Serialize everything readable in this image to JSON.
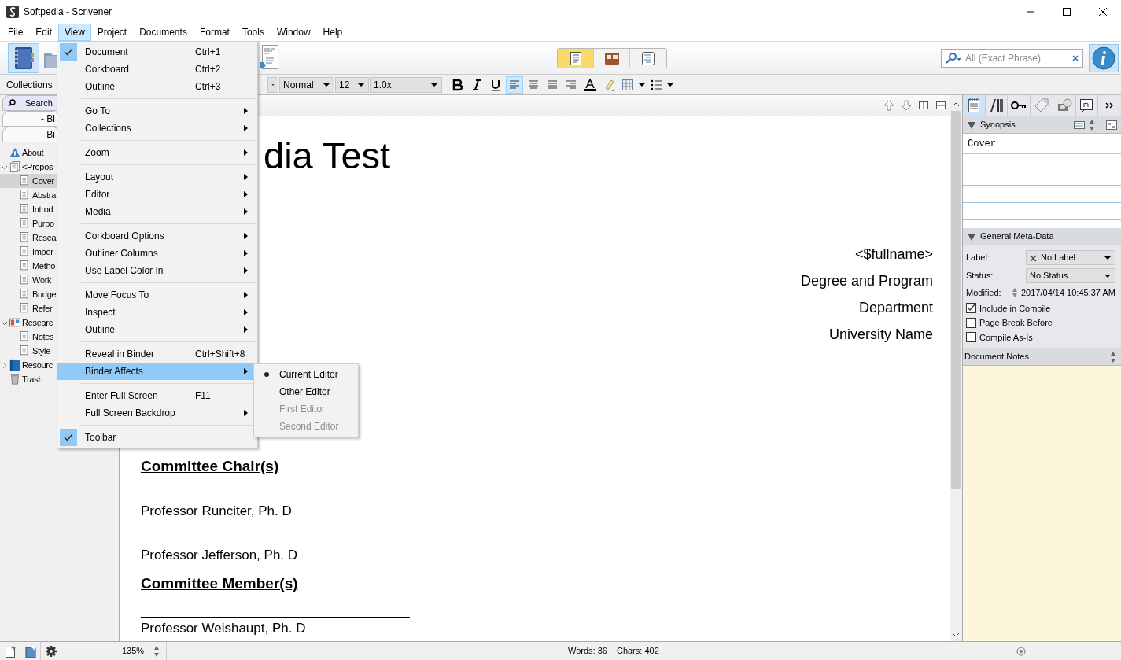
{
  "window": {
    "title": "Softpedia - Scrivener"
  },
  "menubar": [
    {
      "label": "File",
      "selected": false
    },
    {
      "label": "Edit",
      "selected": false
    },
    {
      "label": "View",
      "selected": true
    },
    {
      "label": "Project",
      "selected": false
    },
    {
      "label": "Documents",
      "selected": false
    },
    {
      "label": "Format",
      "selected": false
    },
    {
      "label": "Tools",
      "selected": false
    },
    {
      "label": "Window",
      "selected": false
    },
    {
      "label": "Help",
      "selected": false
    }
  ],
  "view_menu": [
    {
      "kind": "item",
      "label": "Document",
      "shortcut": "Ctrl+1",
      "checked": true,
      "submenu": false,
      "selected": false
    },
    {
      "kind": "item",
      "label": "Corkboard",
      "shortcut": "Ctrl+2",
      "checked": false,
      "submenu": false,
      "selected": false
    },
    {
      "kind": "item",
      "label": "Outline",
      "shortcut": "Ctrl+3",
      "checked": false,
      "submenu": false,
      "selected": false
    },
    {
      "kind": "separator"
    },
    {
      "kind": "item",
      "label": "Go To",
      "checked": false,
      "submenu": true,
      "selected": false
    },
    {
      "kind": "item",
      "label": "Collections",
      "checked": false,
      "submenu": true,
      "selected": false
    },
    {
      "kind": "separator"
    },
    {
      "kind": "item",
      "label": "Zoom",
      "checked": false,
      "submenu": true,
      "selected": false
    },
    {
      "kind": "separator"
    },
    {
      "kind": "item",
      "label": "Layout",
      "checked": false,
      "submenu": true,
      "selected": false
    },
    {
      "kind": "item",
      "label": "Editor",
      "checked": false,
      "submenu": true,
      "selected": false
    },
    {
      "kind": "item",
      "label": "Media",
      "checked": false,
      "submenu": true,
      "selected": false
    },
    {
      "kind": "separator"
    },
    {
      "kind": "item",
      "label": "Corkboard Options",
      "checked": false,
      "submenu": true,
      "selected": false
    },
    {
      "kind": "item",
      "label": "Outliner Columns",
      "checked": false,
      "submenu": true,
      "selected": false
    },
    {
      "kind": "item",
      "label": "Use Label Color In",
      "checked": false,
      "submenu": true,
      "selected": false
    },
    {
      "kind": "separator"
    },
    {
      "kind": "item",
      "label": "Move Focus To",
      "checked": false,
      "submenu": true,
      "selected": false
    },
    {
      "kind": "item",
      "label": "Inspect",
      "checked": false,
      "submenu": true,
      "selected": false
    },
    {
      "kind": "item",
      "label": "Outline",
      "checked": false,
      "submenu": true,
      "selected": false
    },
    {
      "kind": "separator"
    },
    {
      "kind": "item",
      "label": "Reveal in Binder",
      "shortcut": "Ctrl+Shift+8",
      "checked": false,
      "submenu": false,
      "selected": false
    },
    {
      "kind": "item",
      "label": "Binder Affects",
      "checked": false,
      "submenu": true,
      "selected": true
    },
    {
      "kind": "separator"
    },
    {
      "kind": "item",
      "label": "Enter Full Screen",
      "shortcut": "F11",
      "checked": false,
      "submenu": false,
      "selected": false
    },
    {
      "kind": "item",
      "label": "Full Screen Backdrop",
      "checked": false,
      "submenu": true,
      "selected": false
    },
    {
      "kind": "separator"
    },
    {
      "kind": "item",
      "label": "Toolbar",
      "checked": true,
      "submenu": false,
      "selected": false
    }
  ],
  "binder_affects_menu": [
    {
      "label": "Current Editor",
      "selected": true,
      "disabled": false
    },
    {
      "label": "Other Editor",
      "selected": false,
      "disabled": false
    },
    {
      "label": "First Editor",
      "selected": false,
      "disabled": true
    },
    {
      "label": "Second Editor",
      "selected": false,
      "disabled": true
    }
  ],
  "toolbar": {
    "view_modes": [
      {
        "selected": true
      },
      {
        "selected": false
      },
      {
        "selected": false
      }
    ],
    "search": {
      "placeholder": "All (Exact Phrase)"
    }
  },
  "format_bar": {
    "collections_label": "Collections",
    "style": "Normal",
    "size": "12",
    "spacing": "1.0x"
  },
  "binder": {
    "tabs": [
      {
        "label": "Search",
        "selected": true
      },
      {
        "label": "- Bi",
        "selected": false
      },
      {
        "label": "Bi",
        "selected": false
      }
    ],
    "items": [
      {
        "kind": "info",
        "label": "About",
        "selected": false
      },
      {
        "kind": "folder",
        "label": "<Propos",
        "selected": false,
        "expanded": true,
        "children": [
          {
            "kind": "doc",
            "label": "Cover",
            "selected": true
          },
          {
            "kind": "doc",
            "label": "Abstra",
            "selected": false
          },
          {
            "kind": "doc",
            "label": "Introd",
            "selected": false
          },
          {
            "kind": "doc",
            "label": "Purpo",
            "selected": false
          },
          {
            "kind": "doc",
            "label": "Resea",
            "selected": false
          },
          {
            "kind": "doc",
            "label": "Impor",
            "selected": false
          },
          {
            "kind": "doc",
            "label": "Metho",
            "selected": false
          },
          {
            "kind": "doc",
            "label": "Work",
            "selected": false
          },
          {
            "kind": "doc",
            "label": "Budge",
            "selected": false
          },
          {
            "kind": "doc",
            "label": "Refer",
            "selected": false
          }
        ]
      },
      {
        "kind": "research",
        "label": "Researc",
        "selected": false,
        "expanded": true,
        "children": [
          {
            "kind": "doc",
            "label": "Notes",
            "selected": false
          },
          {
            "kind": "doc",
            "label": "Style",
            "selected": false
          }
        ]
      },
      {
        "kind": "resources",
        "label": "Resourc",
        "selected": false,
        "expanded": false
      },
      {
        "kind": "trash",
        "label": "Trash",
        "selected": false
      }
    ]
  },
  "editor": {
    "title": "dia Test",
    "address_lines": [
      "<$fullname>",
      "Degree and Program",
      "Department",
      "University Name"
    ],
    "sections": [
      {
        "heading": "Committee Chair(s)",
        "names": [
          "Professor Runciter, Ph. D",
          "Professor Jefferson, Ph. D"
        ]
      },
      {
        "heading": "Committee Member(s)",
        "names": [
          "Professor Weishaupt, Ph. D"
        ]
      }
    ]
  },
  "inspector": {
    "synopsis_title": "Synopsis",
    "synopsis": "Cover",
    "metadata_title": "General Meta-Data",
    "fields": [
      {
        "label": "Label:",
        "value": "No Label"
      },
      {
        "label": "Status:",
        "value": "No Status"
      }
    ],
    "modified_label": "Modified:",
    "modified": "2017/04/14 10:45:37 AM",
    "options": [
      {
        "label": "Include in Compile",
        "checked": true
      },
      {
        "label": "Page Break Before",
        "checked": false
      },
      {
        "label": "Compile As-Is",
        "checked": false
      }
    ],
    "notes_title": "Document Notes"
  },
  "status_bar": {
    "zoom": "135%",
    "words": "Words: 36",
    "chars": "Chars: 402"
  }
}
